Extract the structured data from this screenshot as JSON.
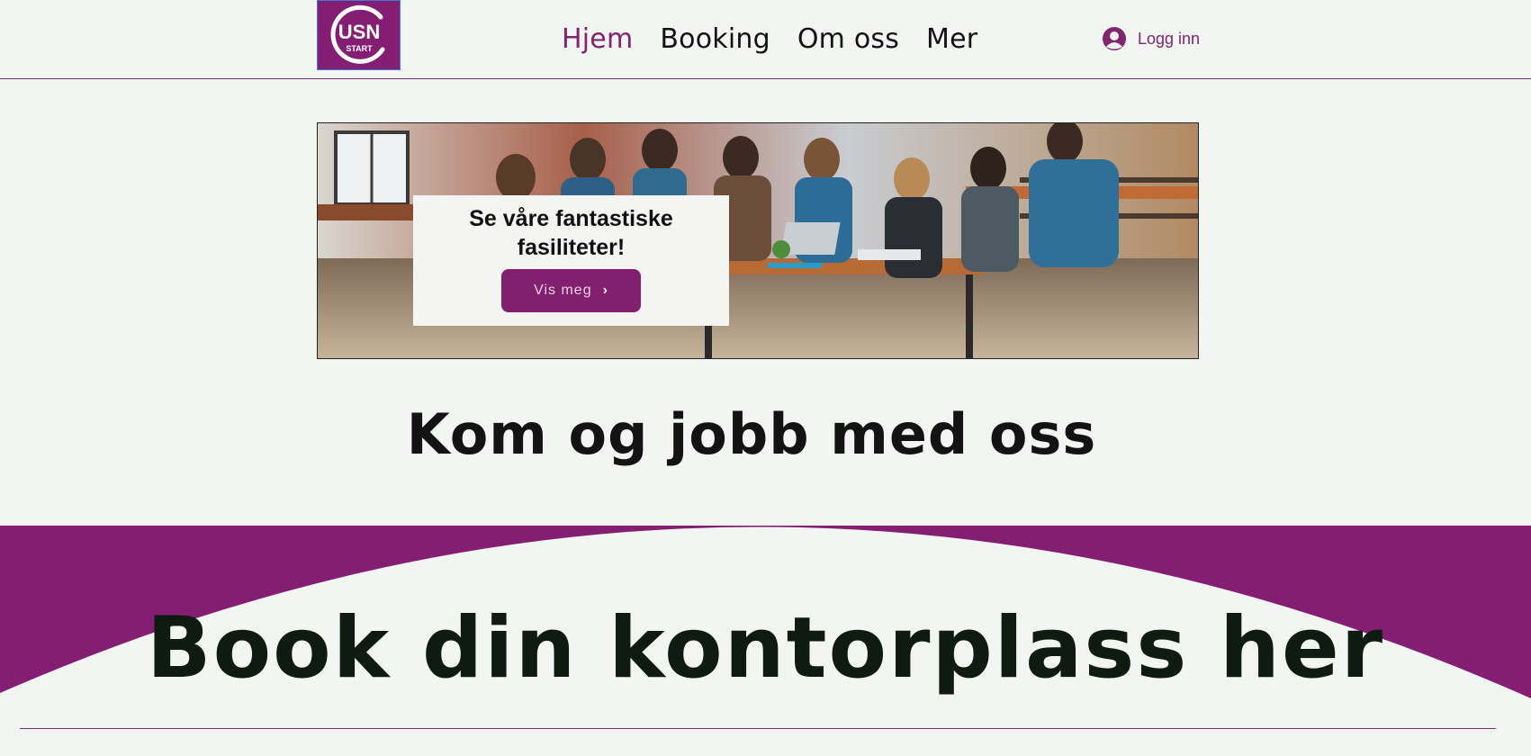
{
  "header": {
    "logo": {
      "text_main": "USN",
      "text_sub": "START",
      "color": "#841e73"
    },
    "nav": [
      {
        "label": "Hjem",
        "active": true
      },
      {
        "label": "Booking",
        "active": false
      },
      {
        "label": "Om oss",
        "active": false
      },
      {
        "label": "Mer",
        "active": false
      }
    ],
    "login": {
      "label": "Logg inn",
      "icon": "user-avatar-icon"
    }
  },
  "hero": {
    "title": "Se våre fantastiske fasiliteter!",
    "button_label": "Vis meg",
    "button_icon": "chevron-right-icon"
  },
  "section_jobb": {
    "heading": "Kom og jobb med oss"
  },
  "section_book": {
    "heading": "Book din kontorplass her"
  },
  "colors": {
    "accent": "#82206f",
    "background": "#f3f5f2",
    "text": "#121212"
  }
}
